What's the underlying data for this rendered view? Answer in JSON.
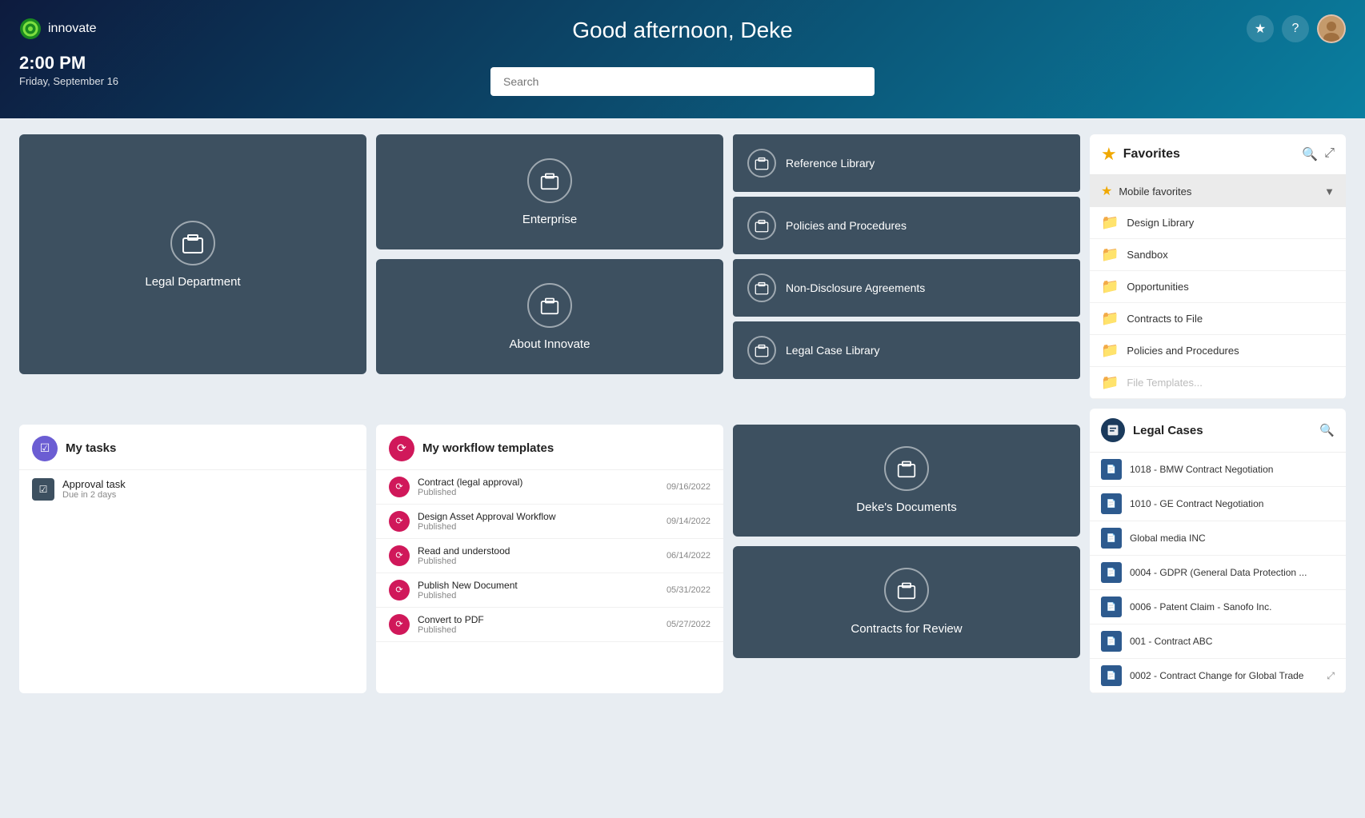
{
  "header": {
    "logo_text": "innovate",
    "greeting": "Good afternoon, Deke",
    "time": "2:00 PM",
    "date": "Friday, September 16",
    "search_placeholder": "Search"
  },
  "tiles": {
    "legal_department": "Legal Department",
    "enterprise": "Enterprise",
    "about_innovate": "About Innovate",
    "reference_library": "Reference Library",
    "policies_procedures": "Policies and Procedures",
    "non_disclosure": "Non-Disclosure Agreements",
    "legal_case_library": "Legal Case Library",
    "dekes_documents": "Deke's Documents",
    "contracts_for_review": "Contracts for Review"
  },
  "favorites": {
    "title": "Favorites",
    "group_label": "Mobile favorites",
    "items": [
      {
        "label": "Design Library"
      },
      {
        "label": "Sandbox"
      },
      {
        "label": "Opportunities"
      },
      {
        "label": "Contracts to File"
      },
      {
        "label": "Policies and Procedures"
      },
      {
        "label": "File Templates..."
      }
    ]
  },
  "tasks": {
    "title": "My tasks",
    "items": [
      {
        "name": "Approval task",
        "due": "Due in 2 days"
      }
    ]
  },
  "workflows": {
    "title": "My workflow templates",
    "items": [
      {
        "name": "Contract (legal approval)",
        "status": "Published",
        "date": "09/16/2022"
      },
      {
        "name": "Design Asset Approval Workflow",
        "status": "Published",
        "date": "09/14/2022"
      },
      {
        "name": "Read and understood",
        "status": "Published",
        "date": "06/14/2022"
      },
      {
        "name": "Publish New Document",
        "status": "Published",
        "date": "05/31/2022"
      },
      {
        "name": "Convert to PDF",
        "status": "Published",
        "date": "05/27/2022"
      }
    ]
  },
  "legal_cases": {
    "title": "Legal Cases",
    "items": [
      {
        "label": "1018 - BMW Contract Negotiation"
      },
      {
        "label": "1010 - GE Contract Negotiation"
      },
      {
        "label": "Global media INC"
      },
      {
        "label": "0004 - GDPR (General Data Protection ..."
      },
      {
        "label": "0006 - Patent Claim - Sanofo Inc."
      },
      {
        "label": "001 - Contract ABC"
      },
      {
        "label": "0002 - Contract Change for Global Trade"
      }
    ]
  }
}
